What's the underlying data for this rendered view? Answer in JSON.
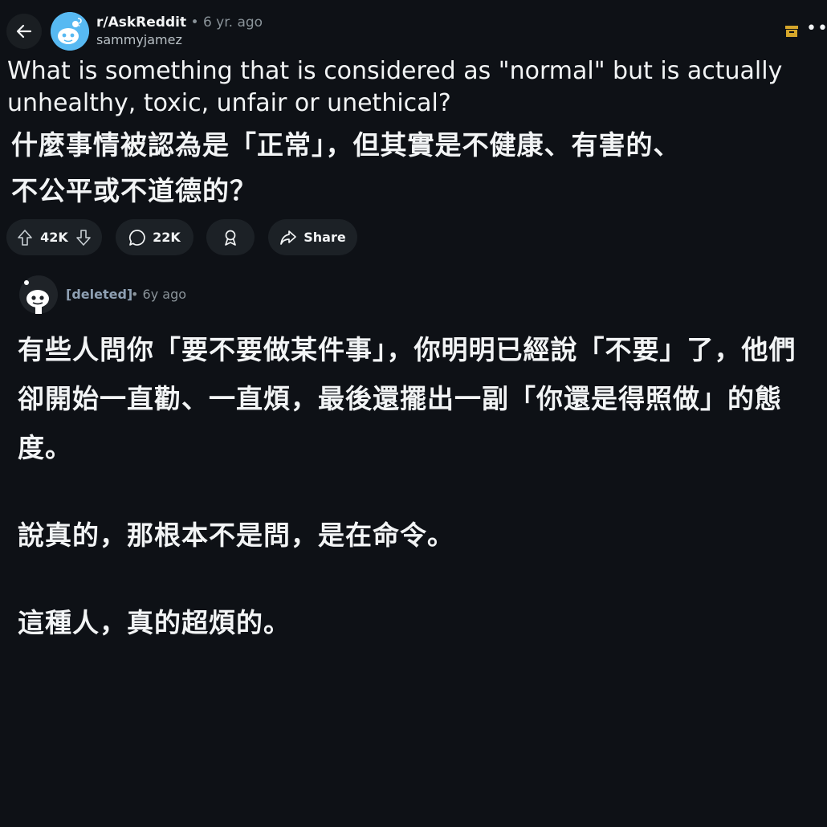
{
  "post": {
    "subreddit": "r/AskReddit",
    "separator": "•",
    "time": "6 yr. ago",
    "author": "sammyjamez",
    "title_en": "What is something that is considered as \"normal\" but is actually unhealthy, toxic, unfair or unethical?",
    "title_zh_line1": "什麼事情被認為是「正常」，但其實是不健康、有害的、",
    "title_zh_line2": "不公平或不道德的？"
  },
  "actions": {
    "upvotes": "42K",
    "comments": "22K",
    "share_label": "Share"
  },
  "comment": {
    "user": "[deleted]",
    "time": "• 6y ago",
    "paragraph1": "有些人問你「要不要做某件事」，你明明已經說「不要」了，他們卻開始一直勸、一直煩，最後還擺出一副「你還是得照做」的態度。",
    "paragraph2": "說真的，那根本不是問，是在命令。",
    "paragraph3": "這種人，真的超煩的。"
  },
  "icons": {
    "back": "arrow-left-icon",
    "archive": "archive-box-icon",
    "more": "more-horizontal-icon",
    "upvote": "arrow-up-icon",
    "downvote": "arrow-down-icon",
    "comment": "speech-bubble-icon",
    "award": "award-icon",
    "share": "share-arrow-icon"
  },
  "colors": {
    "background": "#0e1116",
    "pill": "#1c2126",
    "archive_accent": "#d5a62b",
    "subreddit_avatar": "#57b9f2"
  }
}
